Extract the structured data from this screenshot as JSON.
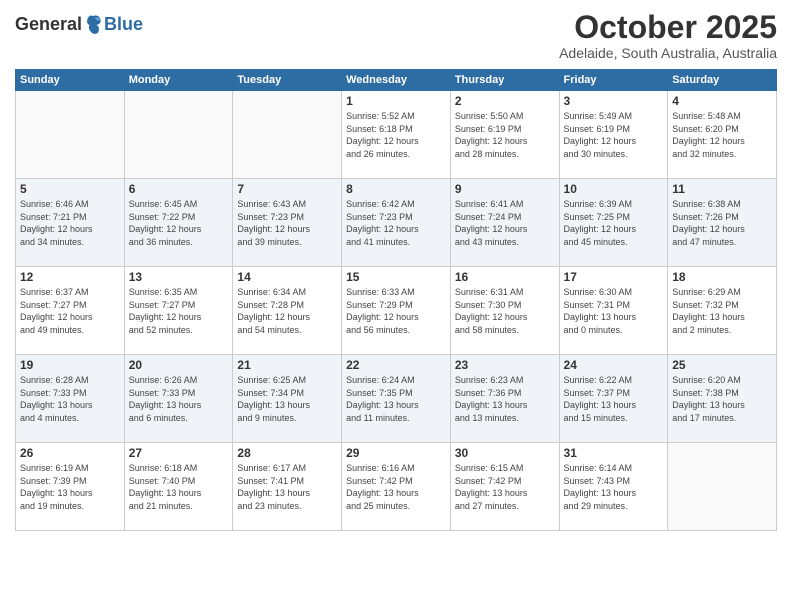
{
  "header": {
    "logo_general": "General",
    "logo_blue": "Blue",
    "month": "October 2025",
    "location": "Adelaide, South Australia, Australia"
  },
  "days_of_week": [
    "Sunday",
    "Monday",
    "Tuesday",
    "Wednesday",
    "Thursday",
    "Friday",
    "Saturday"
  ],
  "weeks": [
    [
      {
        "day": "",
        "info": ""
      },
      {
        "day": "",
        "info": ""
      },
      {
        "day": "",
        "info": ""
      },
      {
        "day": "1",
        "info": "Sunrise: 5:52 AM\nSunset: 6:18 PM\nDaylight: 12 hours\nand 26 minutes."
      },
      {
        "day": "2",
        "info": "Sunrise: 5:50 AM\nSunset: 6:19 PM\nDaylight: 12 hours\nand 28 minutes."
      },
      {
        "day": "3",
        "info": "Sunrise: 5:49 AM\nSunset: 6:19 PM\nDaylight: 12 hours\nand 30 minutes."
      },
      {
        "day": "4",
        "info": "Sunrise: 5:48 AM\nSunset: 6:20 PM\nDaylight: 12 hours\nand 32 minutes."
      }
    ],
    [
      {
        "day": "5",
        "info": "Sunrise: 6:46 AM\nSunset: 7:21 PM\nDaylight: 12 hours\nand 34 minutes."
      },
      {
        "day": "6",
        "info": "Sunrise: 6:45 AM\nSunset: 7:22 PM\nDaylight: 12 hours\nand 36 minutes."
      },
      {
        "day": "7",
        "info": "Sunrise: 6:43 AM\nSunset: 7:23 PM\nDaylight: 12 hours\nand 39 minutes."
      },
      {
        "day": "8",
        "info": "Sunrise: 6:42 AM\nSunset: 7:23 PM\nDaylight: 12 hours\nand 41 minutes."
      },
      {
        "day": "9",
        "info": "Sunrise: 6:41 AM\nSunset: 7:24 PM\nDaylight: 12 hours\nand 43 minutes."
      },
      {
        "day": "10",
        "info": "Sunrise: 6:39 AM\nSunset: 7:25 PM\nDaylight: 12 hours\nand 45 minutes."
      },
      {
        "day": "11",
        "info": "Sunrise: 6:38 AM\nSunset: 7:26 PM\nDaylight: 12 hours\nand 47 minutes."
      }
    ],
    [
      {
        "day": "12",
        "info": "Sunrise: 6:37 AM\nSunset: 7:27 PM\nDaylight: 12 hours\nand 49 minutes."
      },
      {
        "day": "13",
        "info": "Sunrise: 6:35 AM\nSunset: 7:27 PM\nDaylight: 12 hours\nand 52 minutes."
      },
      {
        "day": "14",
        "info": "Sunrise: 6:34 AM\nSunset: 7:28 PM\nDaylight: 12 hours\nand 54 minutes."
      },
      {
        "day": "15",
        "info": "Sunrise: 6:33 AM\nSunset: 7:29 PM\nDaylight: 12 hours\nand 56 minutes."
      },
      {
        "day": "16",
        "info": "Sunrise: 6:31 AM\nSunset: 7:30 PM\nDaylight: 12 hours\nand 58 minutes."
      },
      {
        "day": "17",
        "info": "Sunrise: 6:30 AM\nSunset: 7:31 PM\nDaylight: 13 hours\nand 0 minutes."
      },
      {
        "day": "18",
        "info": "Sunrise: 6:29 AM\nSunset: 7:32 PM\nDaylight: 13 hours\nand 2 minutes."
      }
    ],
    [
      {
        "day": "19",
        "info": "Sunrise: 6:28 AM\nSunset: 7:33 PM\nDaylight: 13 hours\nand 4 minutes."
      },
      {
        "day": "20",
        "info": "Sunrise: 6:26 AM\nSunset: 7:33 PM\nDaylight: 13 hours\nand 6 minutes."
      },
      {
        "day": "21",
        "info": "Sunrise: 6:25 AM\nSunset: 7:34 PM\nDaylight: 13 hours\nand 9 minutes."
      },
      {
        "day": "22",
        "info": "Sunrise: 6:24 AM\nSunset: 7:35 PM\nDaylight: 13 hours\nand 11 minutes."
      },
      {
        "day": "23",
        "info": "Sunrise: 6:23 AM\nSunset: 7:36 PM\nDaylight: 13 hours\nand 13 minutes."
      },
      {
        "day": "24",
        "info": "Sunrise: 6:22 AM\nSunset: 7:37 PM\nDaylight: 13 hours\nand 15 minutes."
      },
      {
        "day": "25",
        "info": "Sunrise: 6:20 AM\nSunset: 7:38 PM\nDaylight: 13 hours\nand 17 minutes."
      }
    ],
    [
      {
        "day": "26",
        "info": "Sunrise: 6:19 AM\nSunset: 7:39 PM\nDaylight: 13 hours\nand 19 minutes."
      },
      {
        "day": "27",
        "info": "Sunrise: 6:18 AM\nSunset: 7:40 PM\nDaylight: 13 hours\nand 21 minutes."
      },
      {
        "day": "28",
        "info": "Sunrise: 6:17 AM\nSunset: 7:41 PM\nDaylight: 13 hours\nand 23 minutes."
      },
      {
        "day": "29",
        "info": "Sunrise: 6:16 AM\nSunset: 7:42 PM\nDaylight: 13 hours\nand 25 minutes."
      },
      {
        "day": "30",
        "info": "Sunrise: 6:15 AM\nSunset: 7:42 PM\nDaylight: 13 hours\nand 27 minutes."
      },
      {
        "day": "31",
        "info": "Sunrise: 6:14 AM\nSunset: 7:43 PM\nDaylight: 13 hours\nand 29 minutes."
      },
      {
        "day": "",
        "info": ""
      }
    ]
  ]
}
